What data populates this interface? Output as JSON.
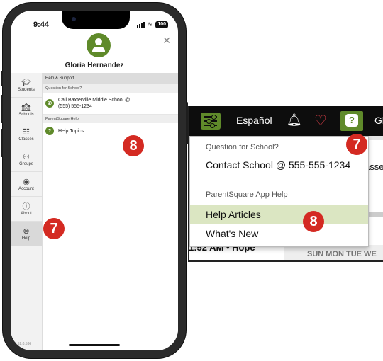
{
  "phone": {
    "status_time": "9:44",
    "battery": "100",
    "user_name": "Gloria Hernandez",
    "sidebar": [
      {
        "label": "Students",
        "icon": "graduation-cap-icon",
        "glyph": "🎓︎"
      },
      {
        "label": "Schools",
        "icon": "school-icon",
        "glyph": "🏫︎"
      },
      {
        "label": "Classes",
        "icon": "classes-icon",
        "glyph": "☷"
      },
      {
        "label": "Groups",
        "icon": "groups-icon",
        "glyph": "⚇"
      },
      {
        "label": "Account",
        "icon": "account-icon",
        "glyph": "◉"
      },
      {
        "label": "About",
        "icon": "info-icon",
        "glyph": "ⓘ"
      },
      {
        "label": "Help",
        "icon": "lifebuoy-icon",
        "glyph": "⊗"
      }
    ],
    "version": "v2.52.0.536",
    "help_section_title": "Help & Support",
    "question_header": "Question for School?",
    "call_school_line1": "Call Baxterville Middle School @",
    "call_school_line2": "(555) 555-1234",
    "parentsquare_help_header": "ParentSquare Help",
    "help_topics": "Help Topics",
    "help_icon_glyph": "?"
  },
  "annotations": {
    "phone_step_a": "7",
    "phone_step_b": "8",
    "desk_step_a": "7",
    "desk_step_b": "8"
  },
  "desktop": {
    "language": "Español",
    "help_glyph": "?",
    "cut_text_right": "Gl",
    "bg_partial_classes": "asse",
    "bg_partial_time": "1:52 AM • Hope",
    "bg_partial_calendar": "SUN MON TUE WE",
    "dropdown": {
      "question_header": "Question for School?",
      "contact_school": "Contact School @ 555-555-1234",
      "app_help_header": "ParentSquare App Help",
      "help_articles": "Help Articles",
      "whats_new": "What's New"
    }
  },
  "colors": {
    "brand_green": "#5f8a2a",
    "annotation_red": "#d42a22",
    "highlight_green": "#dbe6c2"
  }
}
